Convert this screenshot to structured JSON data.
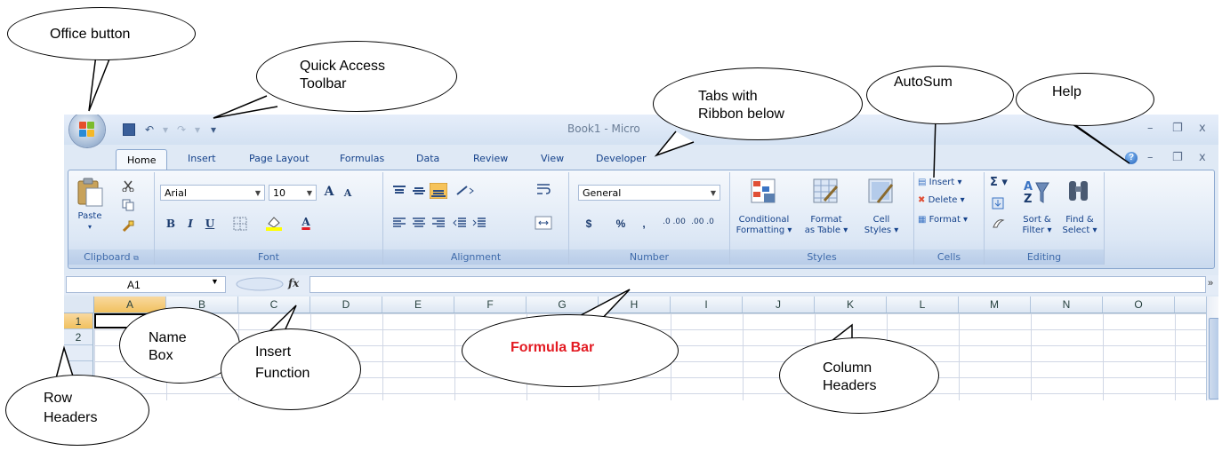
{
  "window": {
    "title": "Book1 - Micro",
    "quick_access": {
      "undo": "↶",
      "undo_arrow": "▾",
      "redo": "↷",
      "redo_arrow": "▾",
      "customize": "▾"
    },
    "controls": {
      "min": "–",
      "restore": "❐",
      "close": "x"
    }
  },
  "tabs": [
    "Home",
    "Insert",
    "Page Layout",
    "Formulas",
    "Data",
    "Review",
    "View",
    "Developer"
  ],
  "ribbon": {
    "clipboard": {
      "label": "Clipboard",
      "paste": "Paste"
    },
    "font": {
      "label": "Font",
      "font_name": "Arial",
      "font_size": "10",
      "grow": "A",
      "shrink": "A",
      "bold": "B",
      "italic": "I",
      "underline": "U",
      "font_color": "A"
    },
    "alignment": {
      "label": "Alignment"
    },
    "number": {
      "label": "Number",
      "format": "General",
      "currency": "$",
      "percent": "%",
      "comma": ",",
      "inc_decimal": ".0 .00",
      "dec_decimal": ".00 .0"
    },
    "styles": {
      "label": "Styles",
      "conditional_1": "Conditional",
      "conditional_2": "Formatting ▾",
      "format_table_1": "Format",
      "format_table_2": "as Table ▾",
      "cell_styles_1": "Cell",
      "cell_styles_2": "Styles ▾"
    },
    "cells": {
      "label": "Cells",
      "insert": "Insert ▾",
      "delete": "Delete ▾",
      "format": "Format ▾"
    },
    "editing": {
      "label": "Editing",
      "autosum": "Σ ▾",
      "sort_1": "Sort &",
      "sort_2": "Filter ▾",
      "find_1": "Find &",
      "find_2": "Select ▾"
    }
  },
  "formula_bar": {
    "name_box": "A1",
    "fx": "fx",
    "expand": "»"
  },
  "columns": [
    "A",
    "B",
    "C",
    "D",
    "E",
    "F",
    "G",
    "H",
    "I",
    "J",
    "K",
    "L",
    "M",
    "N",
    "O"
  ],
  "rows": [
    "1",
    "2"
  ],
  "callouts": {
    "office_button": "Office button",
    "qat_1": "Quick Access",
    "qat_2": "Toolbar",
    "tabs_1": "Tabs with",
    "tabs_2": "Ribbon below",
    "autosum": "AutoSum",
    "help": "Help",
    "name_box_1": "Name",
    "name_box_2": "Box",
    "insert_fn_1": "Insert",
    "insert_fn_2": "Function",
    "formula_bar": "Formula Bar",
    "col_headers_1": "Column",
    "col_headers_2": "Headers",
    "row_headers_1": "Row",
    "row_headers_2": "Headers"
  }
}
